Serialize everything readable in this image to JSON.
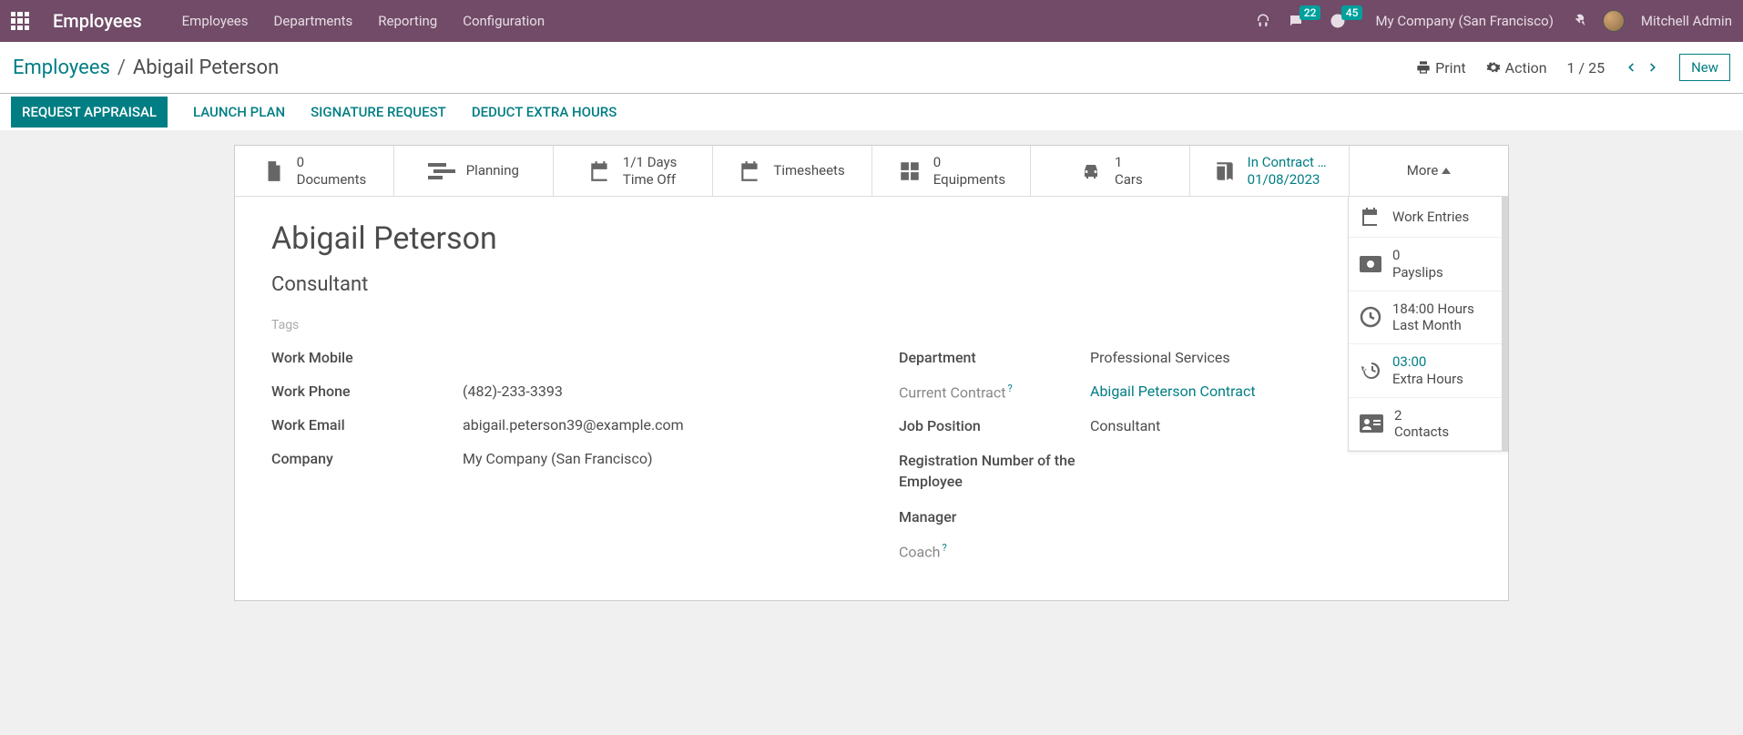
{
  "topbar": {
    "app_title": "Employees",
    "menu": [
      "Employees",
      "Departments",
      "Reporting",
      "Configuration"
    ],
    "messages_badge": "22",
    "activities_badge": "45",
    "company": "My Company (San Francisco)",
    "user": "Mitchell Admin"
  },
  "breadcrumb": {
    "root": "Employees",
    "current": "Abigail Peterson"
  },
  "controls": {
    "print": "Print",
    "action": "Action",
    "pager": "1 / 25",
    "new_btn": "New"
  },
  "actions": {
    "primary": "REQUEST APPRAISAL",
    "items": [
      "LAUNCH PLAN",
      "SIGNATURE REQUEST",
      "DEDUCT EXTRA HOURS"
    ]
  },
  "stats": {
    "documents": {
      "count": "0",
      "label": "Documents"
    },
    "planning": {
      "label": "Planning"
    },
    "timeoff": {
      "line1": "1/1 Days",
      "line2": "Time Off"
    },
    "timesheets": {
      "label": "Timesheets"
    },
    "equipments": {
      "count": "0",
      "label": "Equipments"
    },
    "cars": {
      "count": "1",
      "label": "Cars"
    },
    "contract": {
      "line1": "In Contract …",
      "line2": "01/08/2023"
    },
    "more": "More"
  },
  "dropdown": {
    "work_entries": {
      "label": "Work Entries"
    },
    "payslips": {
      "count": "0",
      "label": "Payslips"
    },
    "last_month": {
      "line1": "184:00 Hours",
      "line2": "Last Month"
    },
    "extra": {
      "line1": "03:00",
      "line2": "Extra Hours"
    },
    "contacts": {
      "count": "2",
      "label": "Contacts"
    }
  },
  "employee": {
    "name": "Abigail Peterson",
    "title": "Consultant",
    "tags_label": "Tags",
    "left": {
      "work_mobile_label": "Work Mobile",
      "work_mobile": "",
      "work_phone_label": "Work Phone",
      "work_phone": "(482)-233-3393",
      "work_email_label": "Work Email",
      "work_email": "abigail.peterson39@example.com",
      "company_label": "Company",
      "company": "My Company (San Francisco)"
    },
    "right": {
      "department_label": "Department",
      "department": "Professional Services",
      "contract_label": "Current Contract",
      "contract": "Abigail Peterson Contract",
      "position_label": "Job Position",
      "position": "Consultant",
      "regnum_label": "Registration Number of the Employee",
      "regnum": "",
      "manager_label": "Manager",
      "manager": "",
      "coach_label": "Coach",
      "coach": ""
    }
  }
}
